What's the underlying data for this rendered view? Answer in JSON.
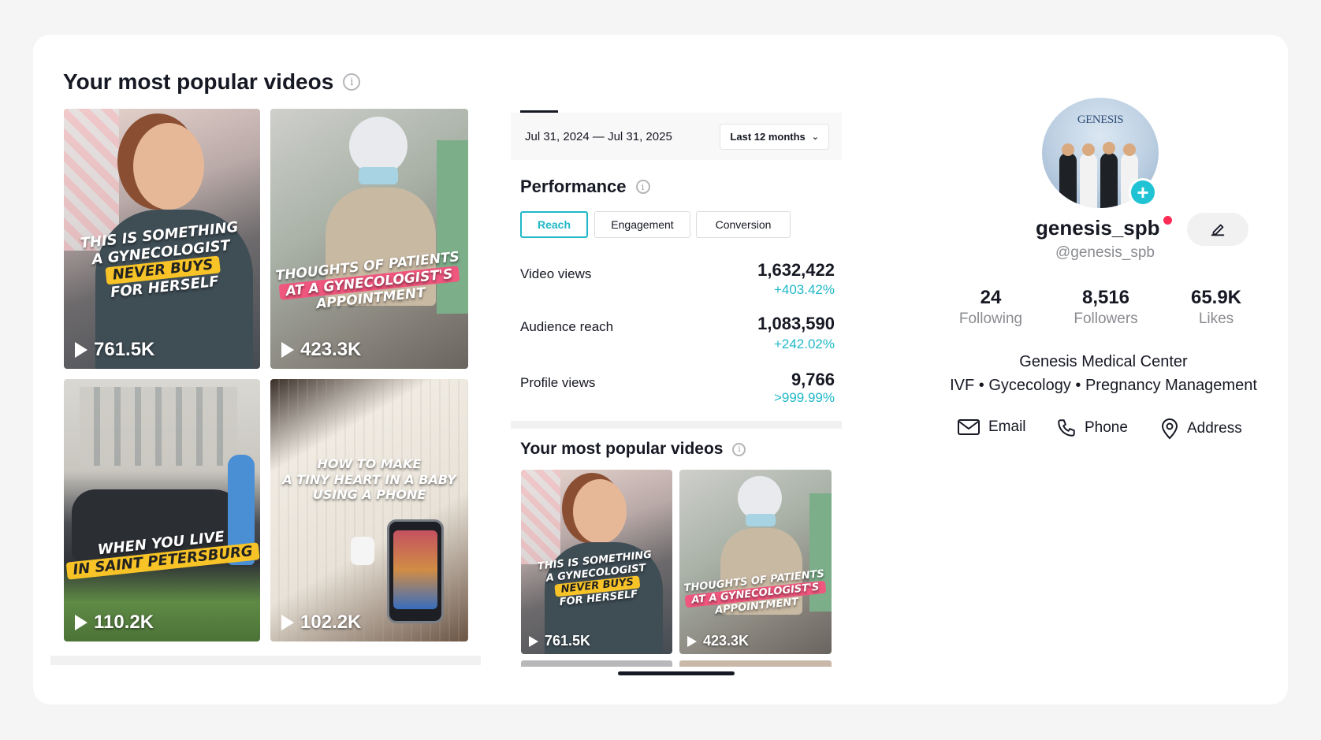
{
  "left_panel": {
    "title": "Your most popular videos",
    "info_icon": "info-icon",
    "videos": [
      {
        "lines": [
          "THIS IS SOMETHING",
          "A GYNECOLOGIST"
        ],
        "highlight": "NEVER BUYS",
        "tail": "FOR HERSELF",
        "views": "761.5K"
      },
      {
        "lines": [
          "THOUGHTS OF PATIENTS"
        ],
        "highlight": "AT A GYNECOLOGIST'S",
        "tail": "APPOINTMENT",
        "views": "423.3K"
      },
      {
        "lines": [
          "WHEN YOU LIVE"
        ],
        "highlight": "IN SAINT PETERSBURG",
        "tail": "",
        "views": "110.2K"
      },
      {
        "lines": [
          "HOW TO MAKE",
          "A TINY HEART IN A BABY",
          "USING A PHONE"
        ],
        "highlight": "",
        "tail": "",
        "views": "102.2K"
      }
    ]
  },
  "middle_panel": {
    "date_range": "Jul 31, 2024 — Jul 31, 2025",
    "range_button": "Last 12 months",
    "performance_title": "Performance",
    "tabs": [
      "Reach",
      "Engagement",
      "Conversion"
    ],
    "active_tab": "Reach",
    "metrics": [
      {
        "label": "Video views",
        "value": "1,632,422",
        "change": "+403.42%"
      },
      {
        "label": "Audience reach",
        "value": "1,083,590",
        "change": "+242.02%"
      },
      {
        "label": "Profile views",
        "value": "9,766",
        "change": ">999.99%"
      }
    ],
    "videos_title": "Your most popular videos",
    "videos": [
      {
        "lines": [
          "THIS IS SOMETHING",
          "A GYNECOLOGIST"
        ],
        "highlight": "NEVER BUYS",
        "tail": "FOR HERSELF",
        "views": "761.5K"
      },
      {
        "lines": [
          "THOUGHTS OF PATIENTS"
        ],
        "highlight": "AT A GYNECOLOGIST'S",
        "tail": "APPOINTMENT",
        "views": "423.3K"
      }
    ]
  },
  "profile": {
    "avatar_brand": "GENESIS",
    "username": "genesis_spb",
    "handle": "@genesis_spb",
    "stats": [
      {
        "value": "24",
        "label": "Following"
      },
      {
        "value": "8,516",
        "label": "Followers"
      },
      {
        "value": "65.9K",
        "label": "Likes"
      }
    ],
    "bio_line1": "Genesis Medical Center",
    "bio_line2": "IVF • Gycecology • Pregnancy Management",
    "contacts": [
      {
        "label": "Email",
        "icon": "mail-icon"
      },
      {
        "label": "Phone",
        "icon": "phone-icon"
      },
      {
        "label": "Address",
        "icon": "location-pin-icon"
      }
    ]
  },
  "colors": {
    "accent": "#20b8c8",
    "badge": "#20c3d3",
    "live_dot": "#fe2c55",
    "highlight_yellow": "#f7c327",
    "highlight_pink": "#f0577e"
  }
}
